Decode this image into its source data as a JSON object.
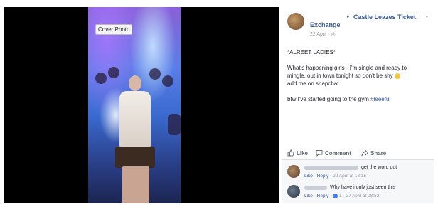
{
  "photo": {
    "cover_button": "Cover Photo"
  },
  "post": {
    "author": "Exchange",
    "arrow": "▸",
    "group": "Castle Leazes Ticket",
    "more": "•",
    "date": "22 April ·",
    "line1": "*ALREET LADIES*",
    "line2": "What's happening girls - I'm single and ready to",
    "line3": "mingle, out in town tonight so don't be shy",
    "line4": "add me on snapchat",
    "line5_text": "btw I've started going to the gym ",
    "hashtag": "#leeeful"
  },
  "actions": {
    "like": "Like",
    "comment": "Comment",
    "share": "Share"
  },
  "comments": [
    {
      "text": "get the word out",
      "like": "Like",
      "sep1": " · ",
      "reply": "Reply",
      "time": " · 22 April at 18:15"
    },
    {
      "text": "Why have i only just seen this",
      "like": "Like",
      "sep1": " · ",
      "reply": "Reply",
      "reaction_count": " 1 ",
      "time": "· 27 April at 08:52"
    }
  ],
  "colors": {
    "link": "#365899",
    "muted": "#90949c",
    "text": "#1d2129"
  }
}
